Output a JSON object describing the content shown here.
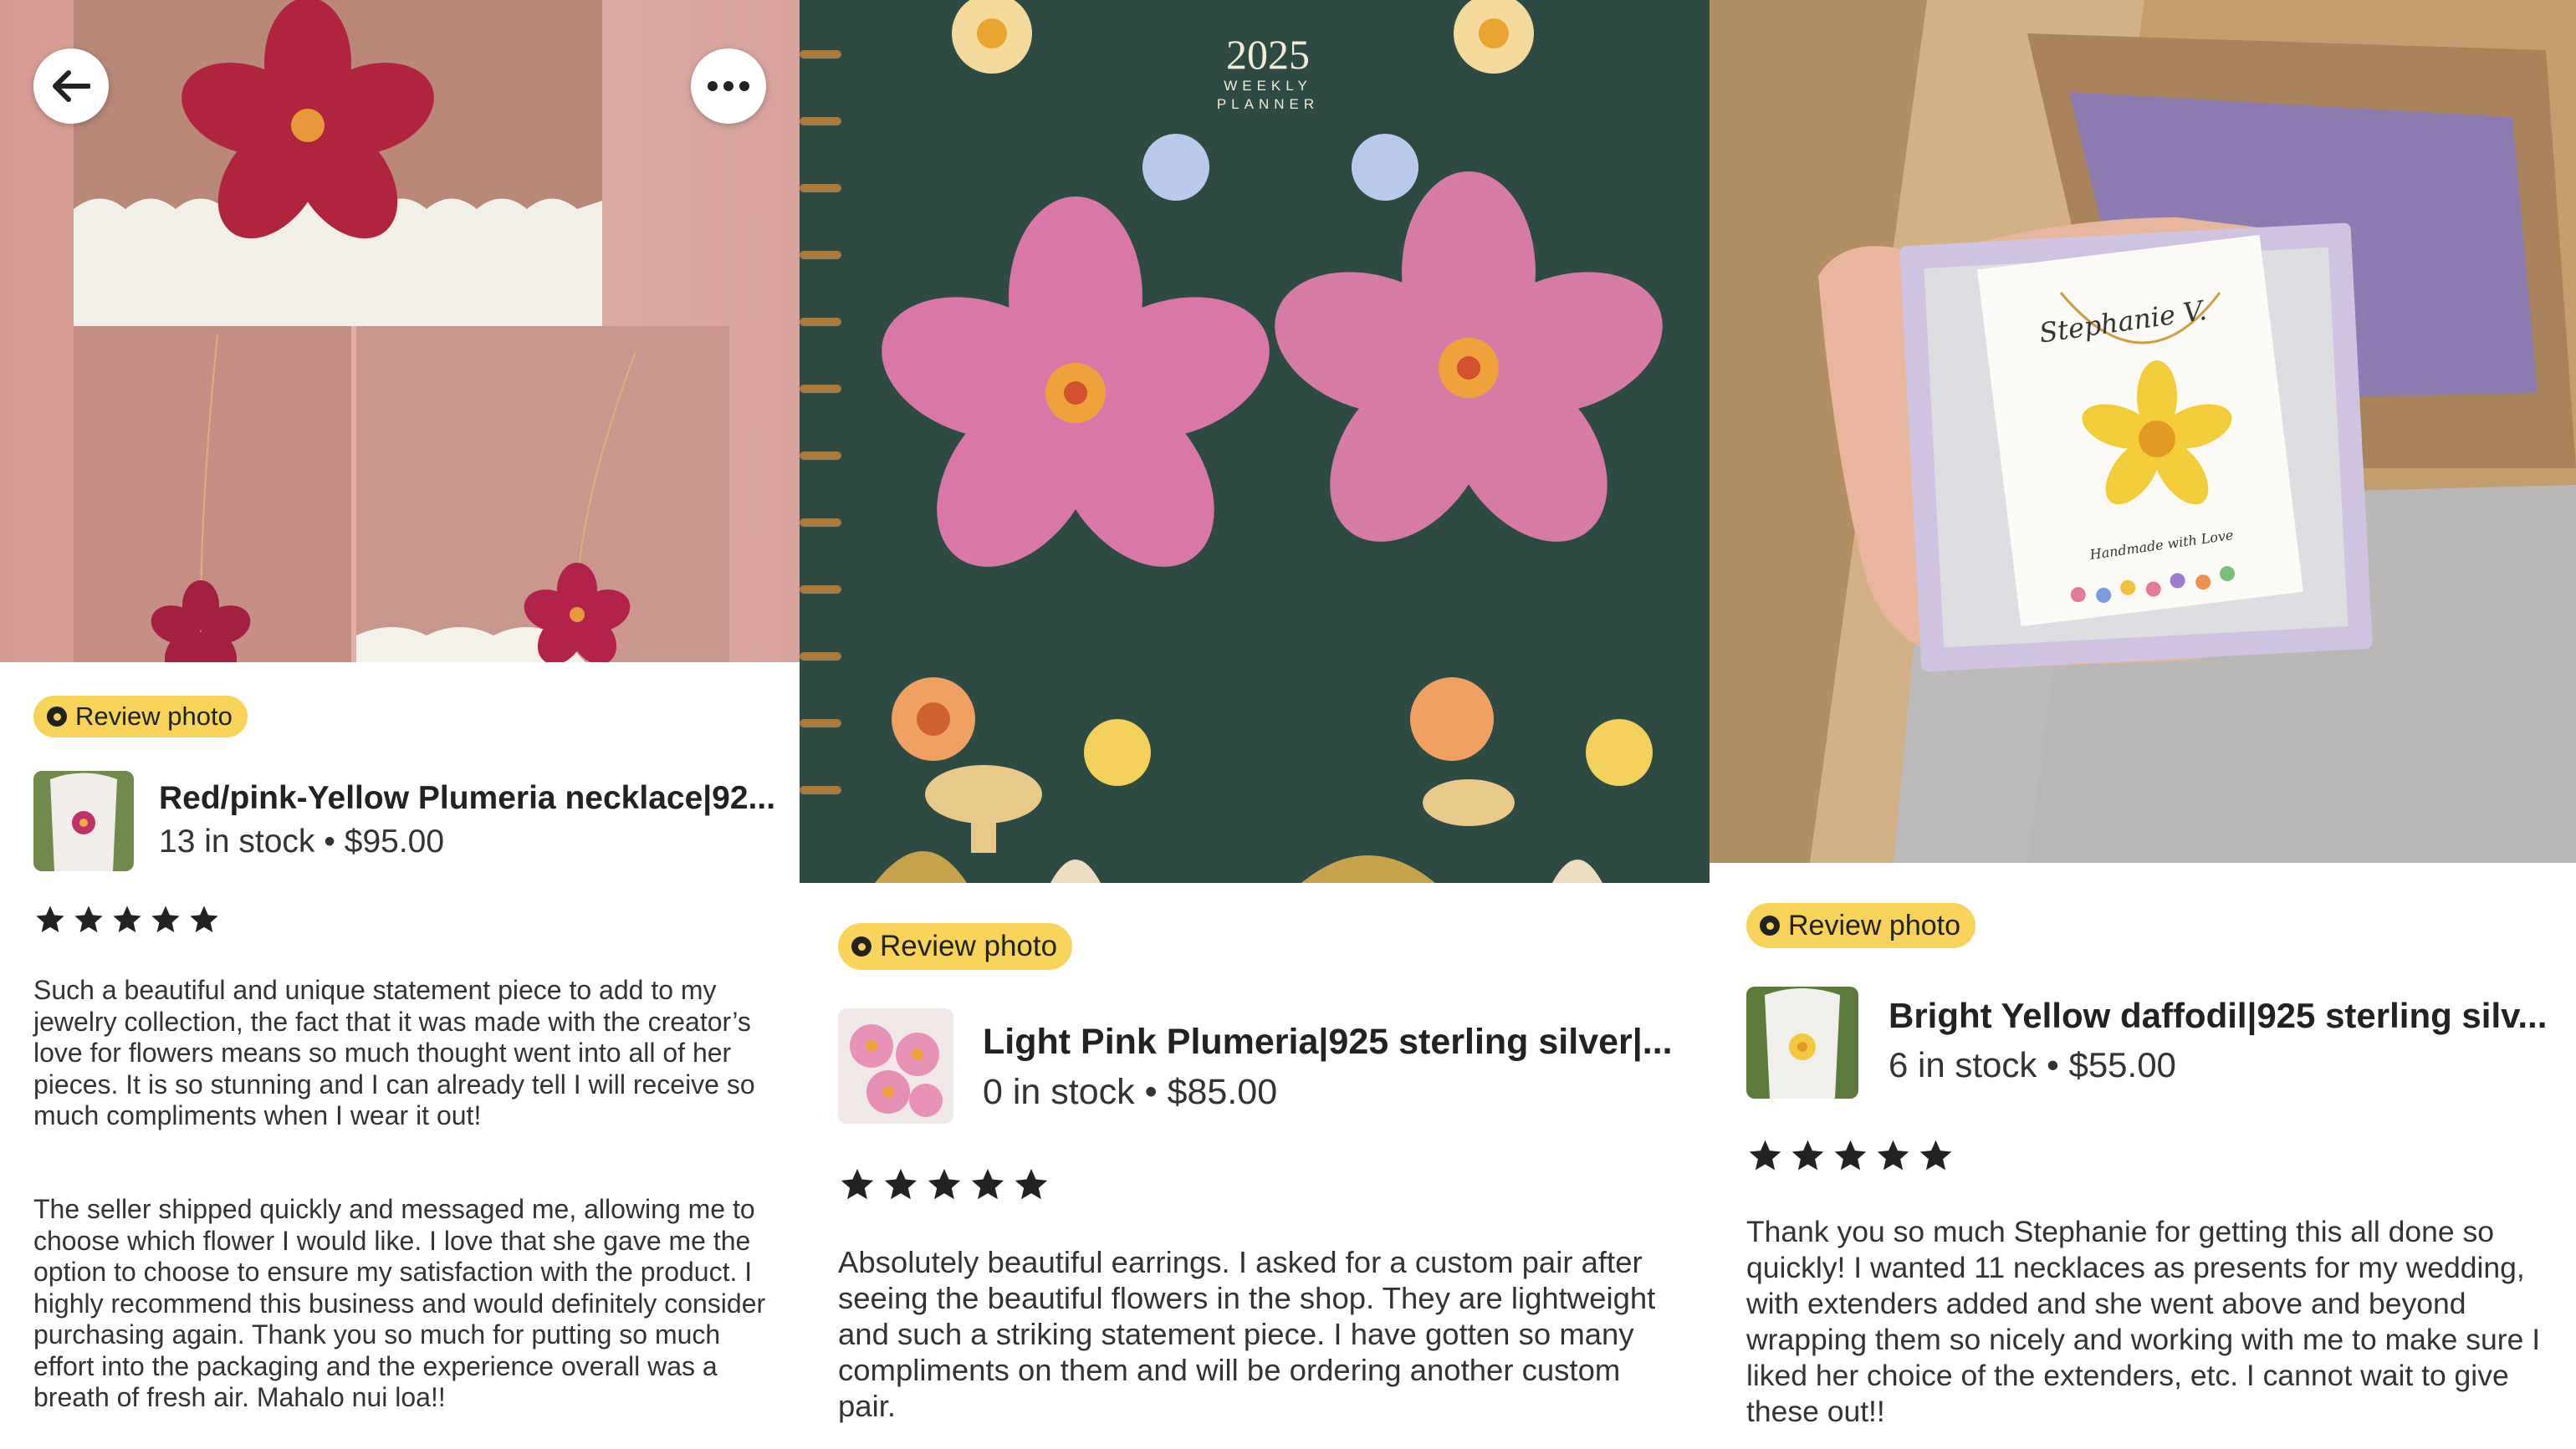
{
  "cards": [
    {
      "badge": "Review photo",
      "title": "Red/pink-Yellow Plumeria necklace|92...",
      "meta": "13 in stock • $95.00",
      "rating": 5,
      "review_p1": "Such a beautiful and unique statement piece to add to my jewelry collection, the fact that it was made with the creator’s love for flowers means so much thought went into all of her pieces. It is so stunning and I can already tell I will receive so much compliments when I wear it out!",
      "review_p2": "The seller shipped quickly and messaged me, allowing me to choose which flower I would like. I love that she gave me the option to choose to ensure my satisfaction with the product. I highly recommend this business and would definitely consider purchasing again. Thank you so much for putting so much effort into the packaging and the experience overall was a breath of fresh air. Mahalo nui loa!!"
    },
    {
      "badge": "Review photo",
      "title": "Light Pink Plumeria|925 sterling silver|...",
      "meta": "0 in stock • $85.00",
      "rating": 5,
      "planner_year": "2025",
      "planner_label_1": "WEEKLY",
      "planner_label_2": "PLANNER",
      "review_p1": "Absolutely beautiful earrings. I asked for a custom pair after seeing the beautiful flowers in the shop. They are lightweight and such a striking statement piece. I have gotten so many compliments on them and will be ordering another custom pair."
    },
    {
      "badge": "Review photo",
      "title": "Bright Yellow daffodil|925 sterling silv...",
      "meta": "6 in stock • $55.00",
      "rating": 5,
      "card_brand": "Stephanie V.",
      "card_tagline": "Handmade with Love",
      "review_p1": "Thank you so much Stephanie for getting this all done so quickly! I wanted 11 necklaces as presents for my wedding, with extenders added and she went above and beyond wrapping them so nicely and working with me to make sure I liked her choice of the extenders, etc. I cannot wait to give these out!!"
    }
  ],
  "icons": {
    "back": "back-arrow-icon",
    "more": "more-options-icon",
    "badge": "camera-icon",
    "star": "star-icon"
  },
  "colors": {
    "badge_bg": "#f7d35a",
    "star": "#222222",
    "text": "#222222"
  }
}
